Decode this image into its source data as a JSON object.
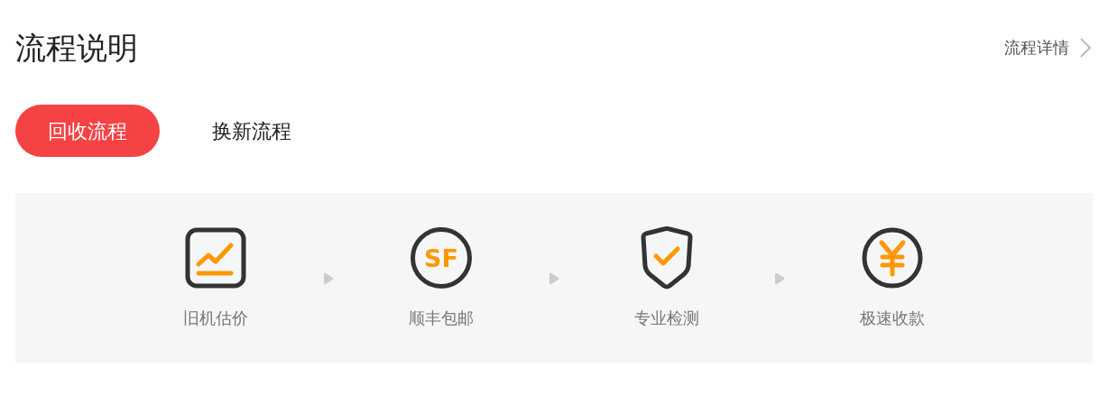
{
  "title": "流程说明",
  "details_link": "流程详情",
  "tabs": [
    {
      "label": "回收流程",
      "selected": true
    },
    {
      "label": "换新流程",
      "selected": false
    }
  ],
  "steps": [
    {
      "kind": "chart",
      "label": "旧机估价"
    },
    {
      "kind": "sf",
      "icon_text": "SF",
      "label": "顺丰包邮"
    },
    {
      "kind": "shield",
      "label": "专业检测"
    },
    {
      "kind": "yen",
      "label": "极速收款"
    }
  ]
}
